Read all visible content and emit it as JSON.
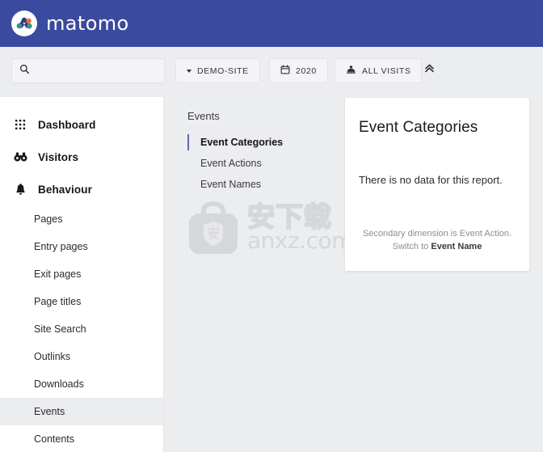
{
  "brand": {
    "name": "matomo",
    "logo_icon": "matomo-logo-icon",
    "header_bg": "#3a4a9f"
  },
  "toolbar": {
    "search": {
      "icon": "search-icon",
      "value": "",
      "placeholder": ""
    },
    "site_selector": {
      "label": "DEMO-SITE",
      "icon": "caret-down-icon"
    },
    "date_selector": {
      "label": "2020",
      "icon": "calendar-icon"
    },
    "segment_selector": {
      "label": "ALL VISITS",
      "icon": "segment-icon"
    },
    "collapse_button": {
      "icon": "chevron-double-up-icon"
    }
  },
  "sidebar": {
    "sections": [
      {
        "label": "Dashboard",
        "icon": "grid-icon",
        "type": "main",
        "active": false
      },
      {
        "label": "Visitors",
        "icon": "binoculars-icon",
        "type": "main",
        "active": false
      },
      {
        "label": "Behaviour",
        "icon": "bell-icon",
        "type": "main",
        "active": false
      }
    ],
    "sub_items": [
      {
        "label": "Pages",
        "active": false
      },
      {
        "label": "Entry pages",
        "active": false
      },
      {
        "label": "Exit pages",
        "active": false
      },
      {
        "label": "Page titles",
        "active": false
      },
      {
        "label": "Site Search",
        "active": false
      },
      {
        "label": "Outlinks",
        "active": false
      },
      {
        "label": "Downloads",
        "active": false
      },
      {
        "label": "Events",
        "active": true
      },
      {
        "label": "Contents",
        "active": false
      }
    ]
  },
  "middle": {
    "title": "Events",
    "items": [
      {
        "label": "Event Categories",
        "active": true
      },
      {
        "label": "Event Actions",
        "active": false
      },
      {
        "label": "Event Names",
        "active": false
      }
    ]
  },
  "report": {
    "title": "Event Categories",
    "empty_message": "There is no data for this report.",
    "footer_prefix": "Secondary dimension is Event Action.",
    "footer_switch_prefix": "Switch to",
    "footer_switch_link": "Event Name"
  },
  "watermark": {
    "chinese": "安下载",
    "domain": "anxz.com",
    "bag_glyph": "安"
  }
}
